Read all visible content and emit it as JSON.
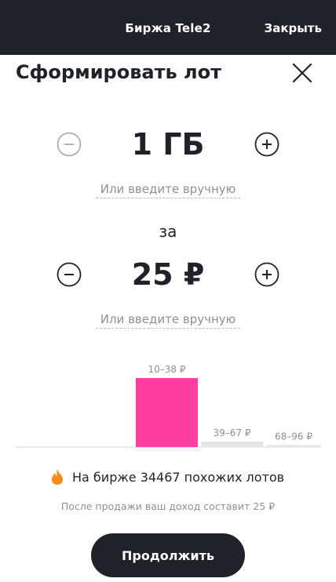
{
  "topbar": {
    "title": "Биржа Tele2",
    "close_label": "Закрыть"
  },
  "heading": "Сформировать лот",
  "amount": {
    "value": "1 ГБ",
    "manual_label": "Или введите вручную"
  },
  "for_label": "за",
  "price": {
    "value": "25 ₽",
    "manual_label": "Или введите вручную"
  },
  "chart_data": {
    "type": "bar",
    "categories": [
      "10–38 ₽",
      "39–67 ₽",
      "68–96 ₽"
    ],
    "values": [
      100,
      8,
      3
    ],
    "active_index": 0,
    "colors": {
      "active": "#ff3fa0",
      "inactive": "#e4e6ea",
      "baseline": "#d5d7db"
    }
  },
  "market": {
    "text": "На бирже 34467 похожих лотов",
    "icon": "flame-icon",
    "icon_color": "#ff8a1c"
  },
  "income_text": "После продажи ваш доход составит 25 ₽",
  "continue_label": "Продолжить"
}
